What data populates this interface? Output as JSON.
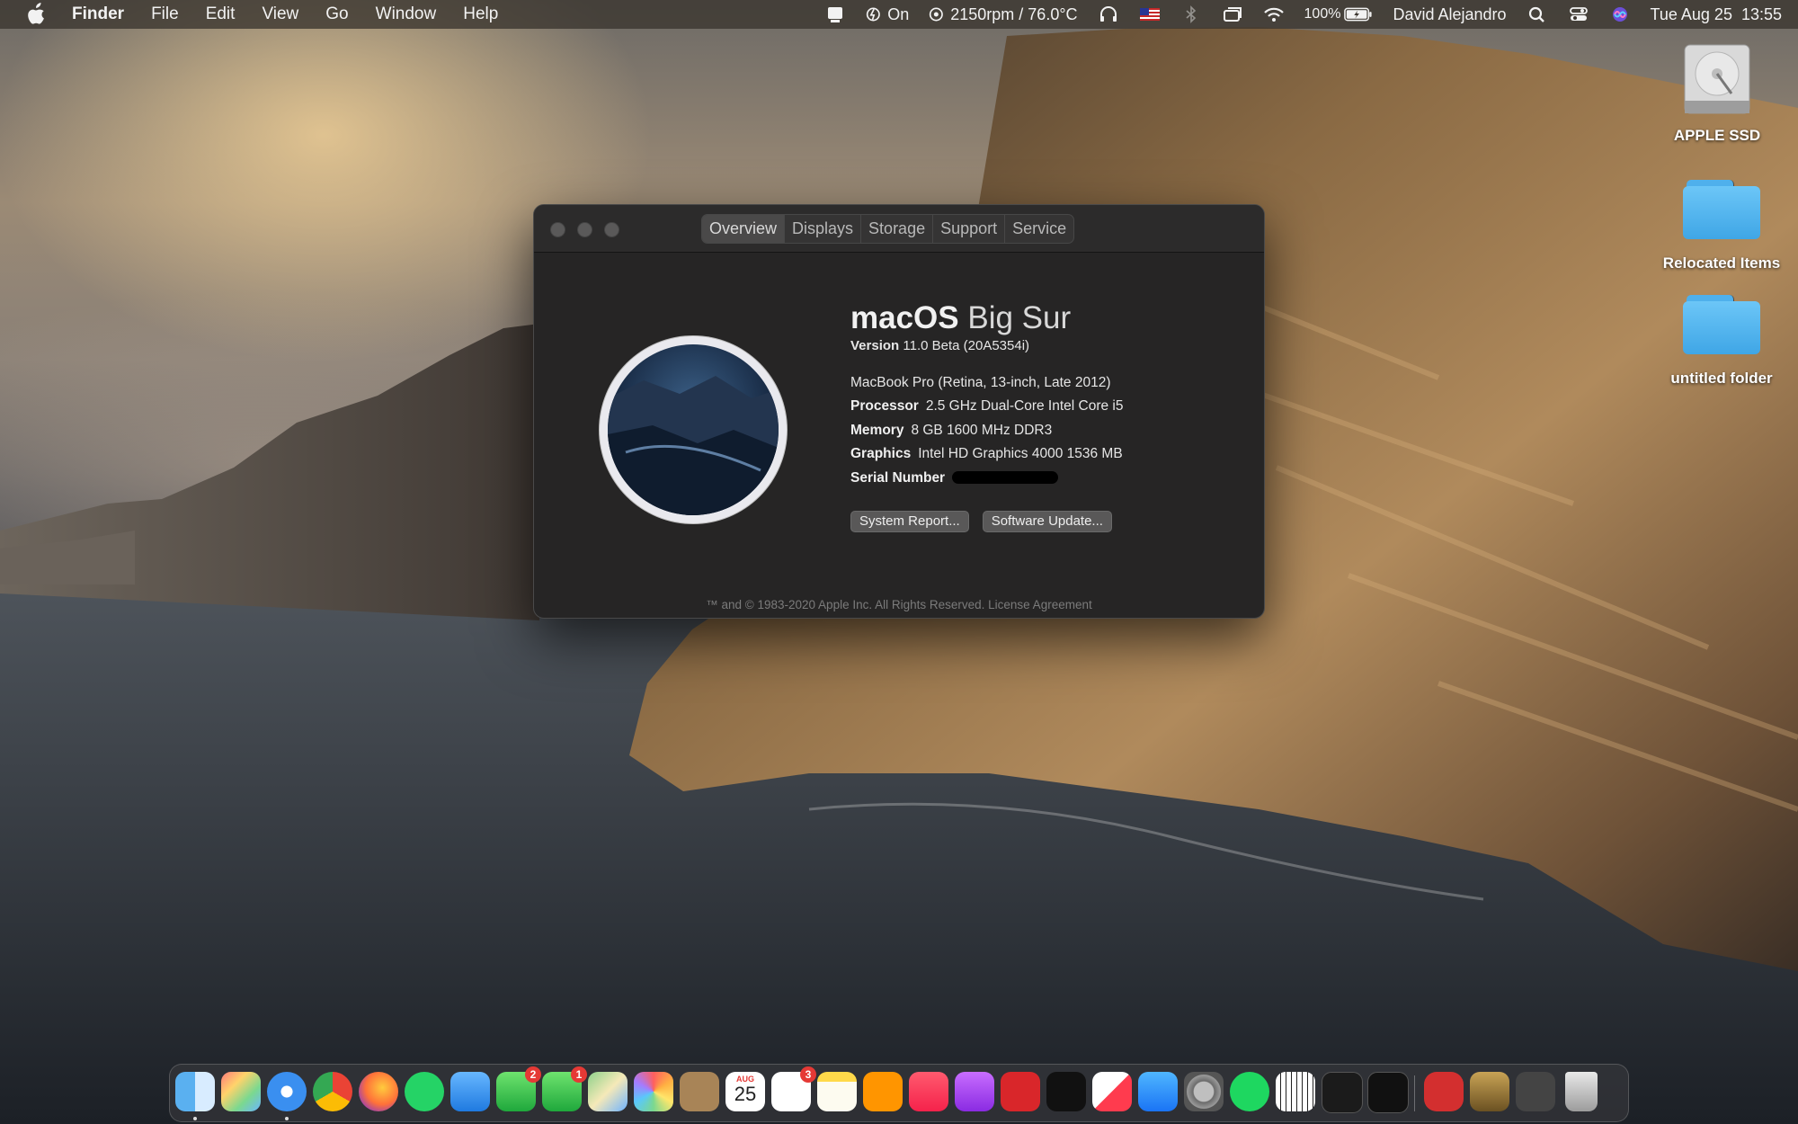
{
  "menubar": {
    "app_name": "Finder",
    "menus": [
      "File",
      "Edit",
      "View",
      "Go",
      "Window",
      "Help"
    ],
    "status": {
      "caffeinate": "On",
      "fan": "2150rpm / 76.0°C",
      "battery": "100%",
      "user": "David Alejandro",
      "datetime": "Tue Aug 25  13:55"
    }
  },
  "desktop": {
    "icons": [
      {
        "label": "APPLE SSD",
        "icon": "hard-disk-icon"
      },
      {
        "label": "Relocated Items",
        "icon": "folder-icon"
      },
      {
        "label": "untitled folder",
        "icon": "folder-icon"
      }
    ]
  },
  "window": {
    "tabs": [
      "Overview",
      "Displays",
      "Storage",
      "Support",
      "Service"
    ],
    "active_tab": "Overview",
    "os_name_bold": "macOS",
    "os_name": "Big Sur",
    "version_label": "Version",
    "version_value": "11.0 Beta (20A5354i)",
    "model": "MacBook Pro (Retina, 13-inch, Late 2012)",
    "specs": [
      {
        "label": "Processor",
        "value": "2.5 GHz Dual-Core Intel Core i5"
      },
      {
        "label": "Memory",
        "value": "8 GB 1600 MHz DDR3"
      },
      {
        "label": "Graphics",
        "value": "Intel HD Graphics 4000 1536 MB"
      },
      {
        "label": "Serial Number",
        "value": ""
      }
    ],
    "buttons": {
      "report": "System Report...",
      "update": "Software Update..."
    },
    "copyright": "™ and © 1983-2020 Apple Inc. All Rights Reserved. License Agreement"
  },
  "dock": {
    "calendar_month": "AUG",
    "calendar_day": "25",
    "facetime_badge": "2",
    "messages_badge": "1",
    "reminders_badge": "3",
    "apps": [
      "finder",
      "launchpad",
      "safari",
      "chrome",
      "firefox",
      "whatsapp",
      "mail",
      "facetime",
      "messages",
      "maps",
      "photos",
      "contacts",
      "calendar",
      "reminders",
      "notes",
      "books",
      "music",
      "podcasts",
      "photo-booth",
      "apple-tv",
      "news",
      "app-store",
      "system-preferences",
      "spotify",
      "piano",
      "terminal",
      "activity-monitor",
      "adblock",
      "league-of-legends",
      "downloads",
      "trash"
    ]
  }
}
